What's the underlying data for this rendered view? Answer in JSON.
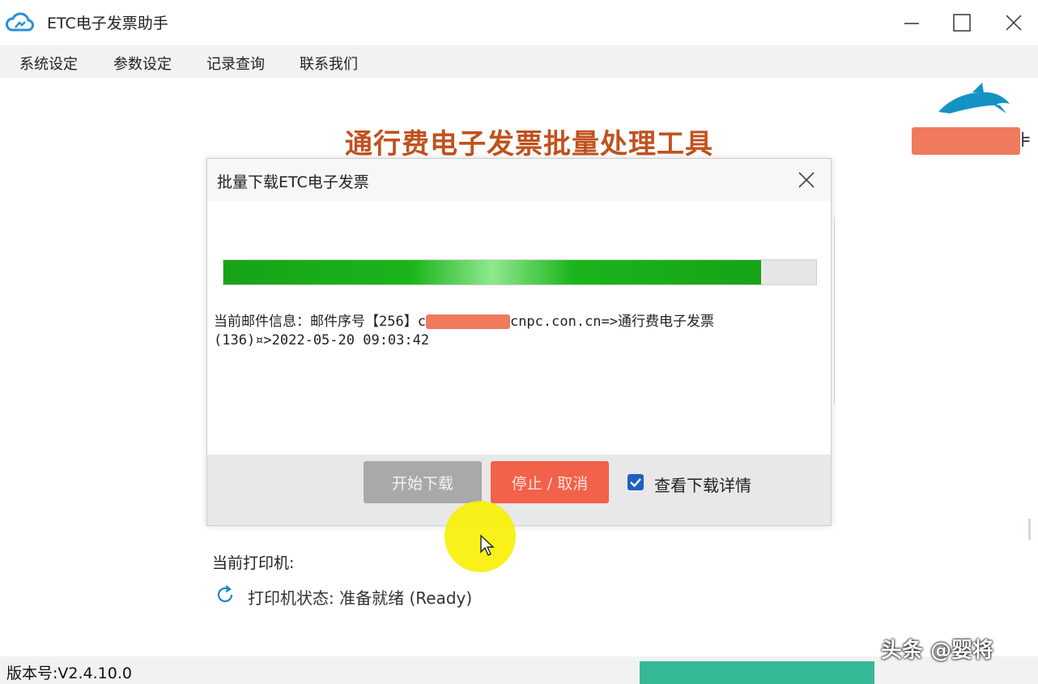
{
  "window": {
    "title": "ETC电子发票助手",
    "icon": "cloud-app-icon"
  },
  "menu": {
    "items": [
      "系统设定",
      "参数设定",
      "记录查询",
      "联系我们"
    ]
  },
  "main": {
    "headline": "通行费电子发票批量处理工具",
    "printer_label": "当前打印机:",
    "printer_status": "打印机状态: 准备就绪 (Ready)"
  },
  "dialog": {
    "title": "批量下载ETC电子发票",
    "progress_fraction": 0.907,
    "info_line1_prefix": "当前邮件信息：邮件序号【256】c",
    "info_line1_suffix": "cnpc.con.cn=>通行费电子发票",
    "info_line2": "(136)¤>2022-05-20 09:03:42",
    "start_button": "开始下载",
    "stop_button": "停止 / 取消",
    "details_checkbox_label": "查看下载详情",
    "details_checked": true
  },
  "status": {
    "version": "版本号:V2.4.10.0"
  },
  "watermark": "头条 @婴将",
  "colors": {
    "headline": "#c0521e",
    "progress": "#1bb51b",
    "stop_button": "#f2614a",
    "start_button": "#a9a9a9",
    "checkbox": "#1f5fbf",
    "highlight": "#f8f000",
    "teal": "#35b997"
  }
}
